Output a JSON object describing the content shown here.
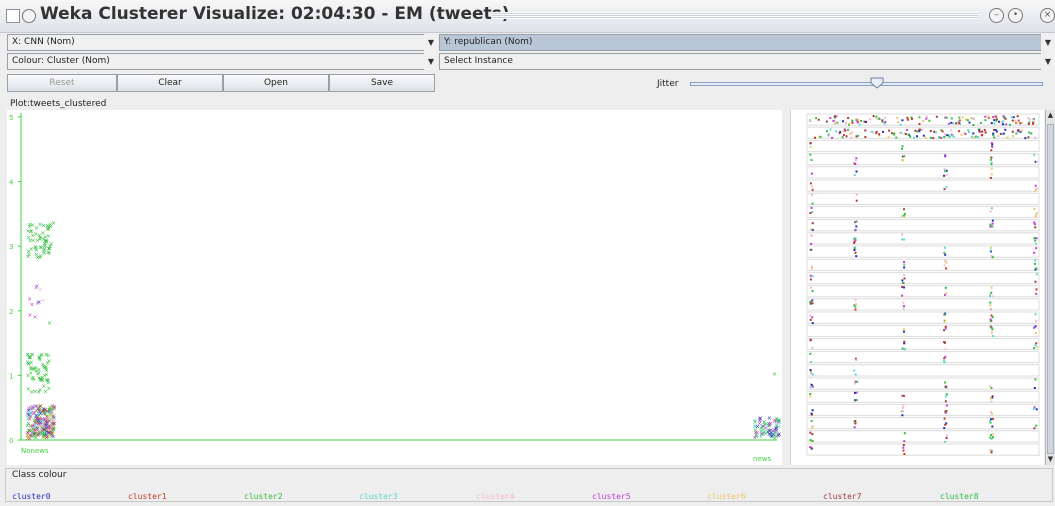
{
  "window": {
    "title": "Weka Clusterer Visualize: 02:04:30 - EM (tweets)"
  },
  "controls": {
    "x_axis": "X: CNN (Nom)",
    "y_axis": "Y: republican (Nom)",
    "colour": "Colour: Cluster (Nom)",
    "select_instance": "Select Instance",
    "reset": "Reset",
    "clear": "Clear",
    "open": "Open",
    "save": "Save",
    "jitter": "Jitter",
    "jitter_level": 0.53
  },
  "plot": {
    "title": "Plot:tweets_clustered",
    "y_ticks": [
      "0",
      "1",
      "2",
      "3",
      "4",
      "5"
    ],
    "x_categories": [
      "Nonews",
      "news"
    ]
  },
  "legend": {
    "title": "Class colour",
    "clusters": [
      {
        "name": "cluster0",
        "color": "#1f2fbf"
      },
      {
        "name": "cluster1",
        "color": "#c0392b"
      },
      {
        "name": "cluster2",
        "color": "#3cbf3c"
      },
      {
        "name": "cluster3",
        "color": "#5ed6d6"
      },
      {
        "name": "cluster4",
        "color": "#f3b7d2"
      },
      {
        "name": "cluster5",
        "color": "#c03fd6"
      },
      {
        "name": "cluster6",
        "color": "#f0c66a"
      },
      {
        "name": "cluster7",
        "color": "#a33a3a"
      },
      {
        "name": "cluster8",
        "color": "#2dbf4a"
      }
    ]
  }
}
